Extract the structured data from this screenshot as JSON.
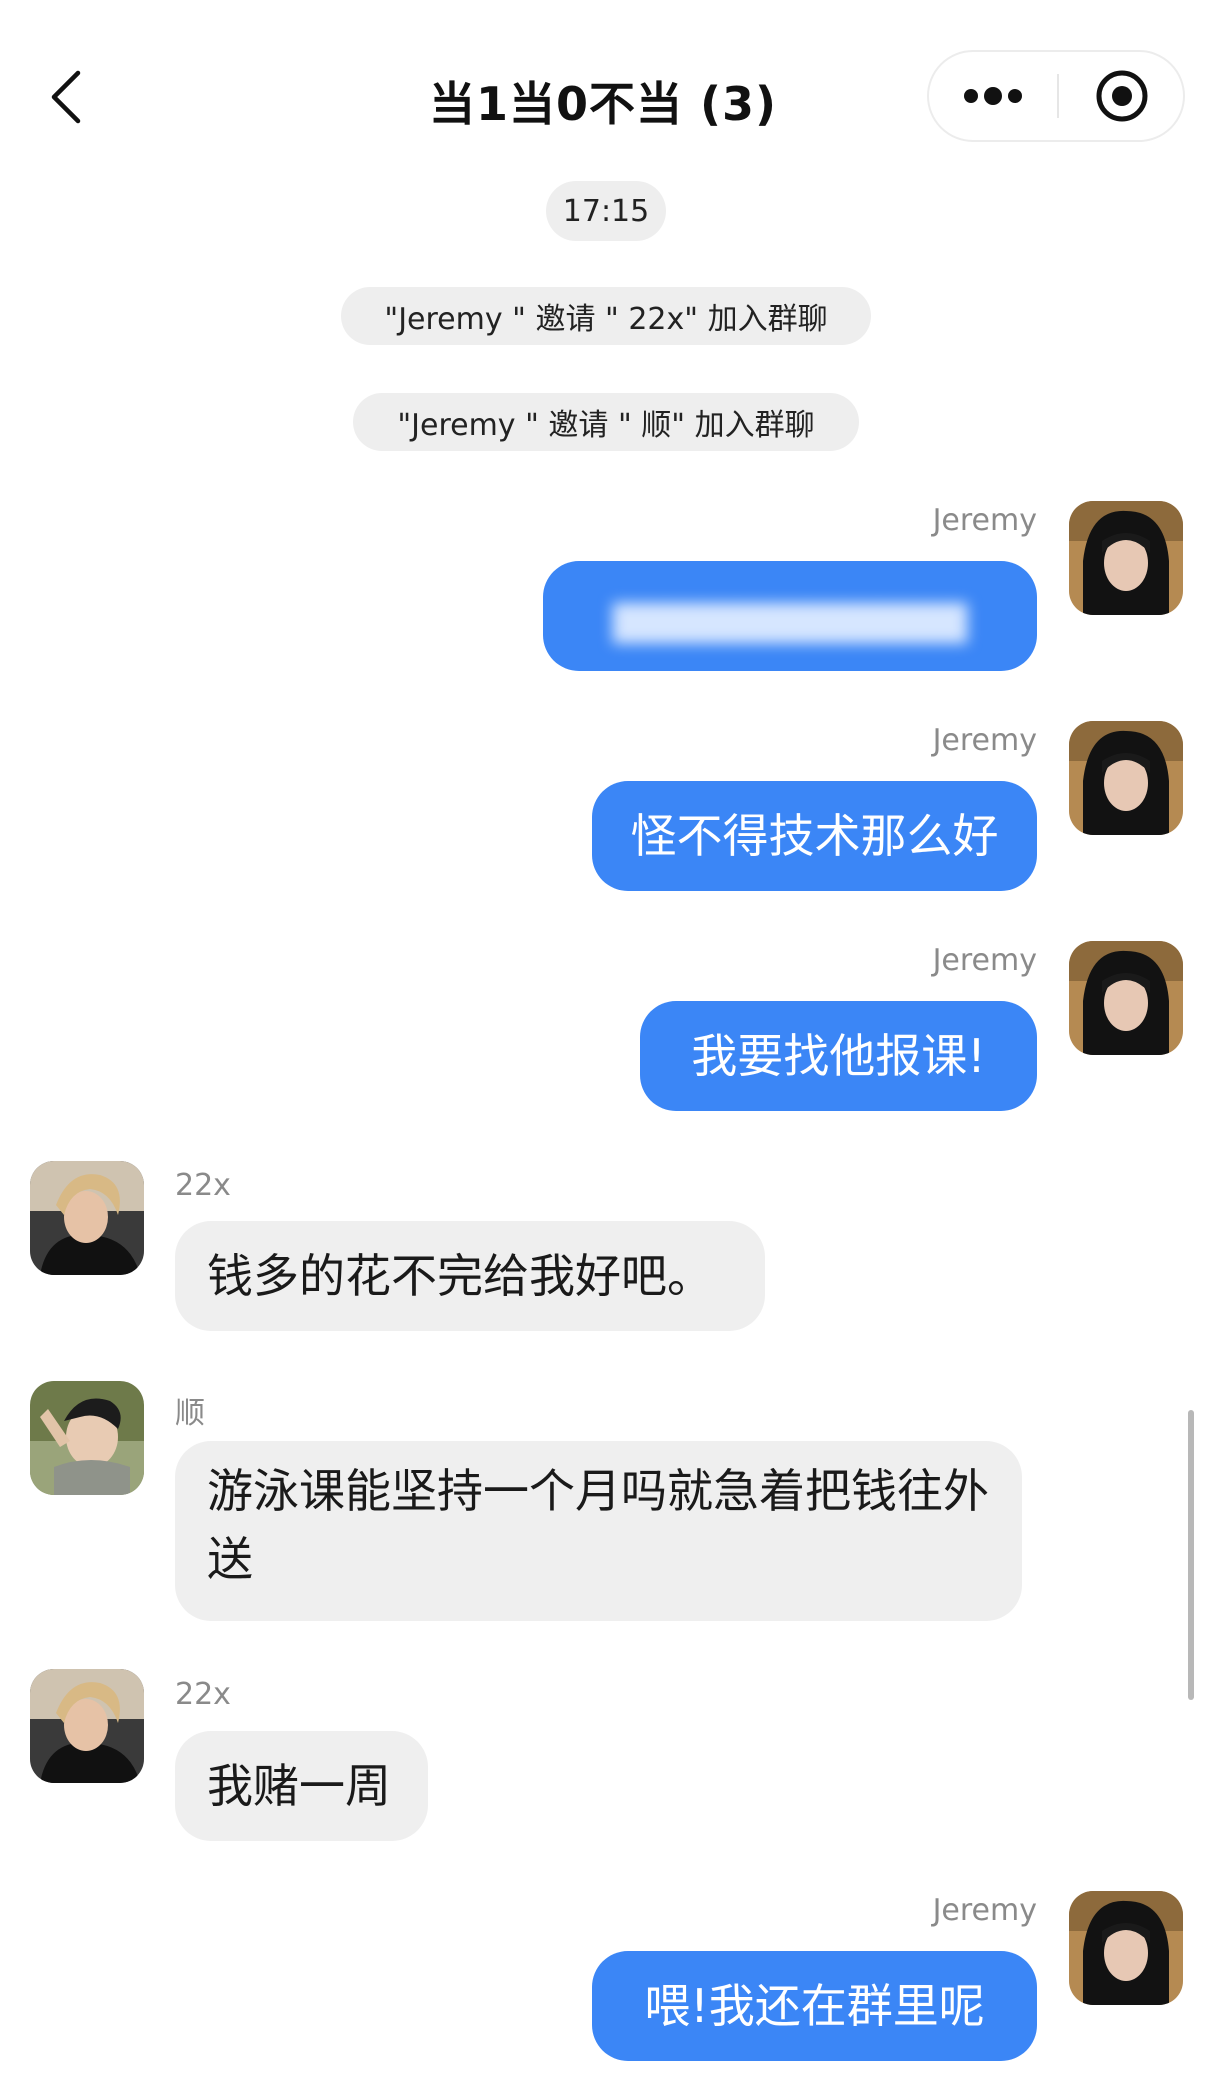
{
  "header": {
    "title": "当1当0不当 (3)",
    "icons": {
      "back": "chevron-left-icon",
      "more": "more-dots-icon",
      "target": "target-icon"
    }
  },
  "system": {
    "time": "17:15",
    "invite1": "\"Jeremy \" 邀请 \" 22x\" 加入群聊",
    "invite2": "\"Jeremy \" 邀请 \" 顺\" 加入群聊"
  },
  "messages": [
    {
      "sender": "Jeremy",
      "text": "",
      "blurred": true
    },
    {
      "sender": "Jeremy",
      "text": "怪不得技术那么好"
    },
    {
      "sender": "Jeremy",
      "text": "我要找他报课!"
    },
    {
      "sender": "22x",
      "text": "钱多的花不完给我好吧。"
    },
    {
      "sender": "顺",
      "text": "游泳课能坚持一个月吗就急着把钱往外送"
    },
    {
      "sender": "22x",
      "text": "我赌一周"
    },
    {
      "sender": "Jeremy",
      "text": "喂!我还在群里呢"
    }
  ],
  "colors": {
    "mine_bubble": "#3b86f6",
    "theirs_bubble": "#efefef",
    "pill": "#eeeeee",
    "name": "#8a8a8a"
  }
}
